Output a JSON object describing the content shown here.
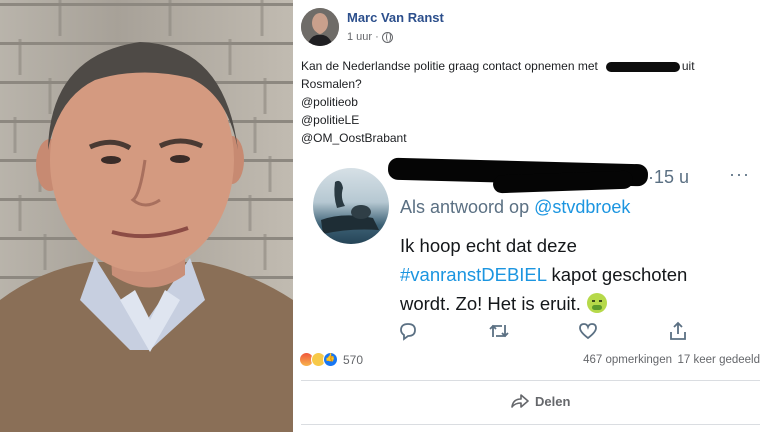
{
  "post": {
    "author": "Marc Van Ranst",
    "time": "1 uur ·",
    "text_line1_a": "Kan de Nederlandse politie graag contact opnemen met",
    "text_line1_b": "uit",
    "text_line2": "Rosmalen?",
    "mention1": "@politieob",
    "mention2": "@politieLE",
    "mention3": "@OM_OostBrabant"
  },
  "tweet": {
    "time": "·15 u",
    "more": "···",
    "reply_prefix": "Als antwoord op",
    "reply_handle": "@stvdbroek",
    "line1": "Ik hoop echt dat deze",
    "hashtag": "#vanranstDEBIEL",
    "line2_rest": " kapot geschoten",
    "line3": "wordt. Zo! Het is eruit."
  },
  "stats": {
    "reactions_count": "570",
    "comments": "467 opmerkingen",
    "shares": "17 keer gedeeld"
  },
  "actions": {
    "share_label": "Delen"
  },
  "icons": [
    "photo-portrait",
    "avatar",
    "globe-icon",
    "tweet-avatar",
    "reply-icon",
    "retweet-icon",
    "like-icon",
    "share-tweet-icon",
    "angry-reaction-icon",
    "wow-reaction-icon",
    "like-reaction-icon",
    "share-icon"
  ],
  "colors": {
    "author": "#2c4f8c",
    "link": "#1b95e0",
    "muted": "#65676b"
  }
}
